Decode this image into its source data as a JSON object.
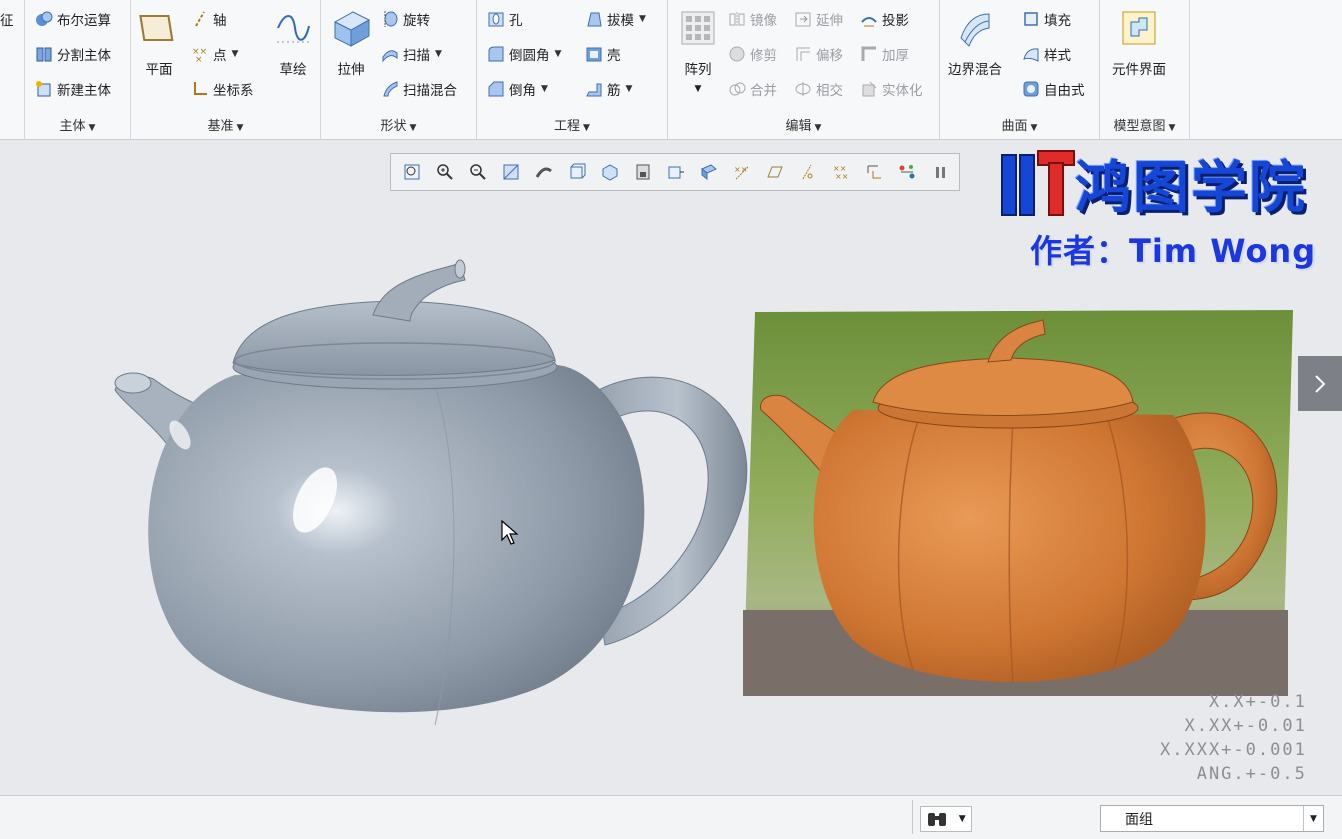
{
  "ribbon": {
    "cut_label": "征",
    "groups": {
      "body": {
        "label": "主体",
        "items": [
          "布尔运算",
          "分割主体",
          "新建主体"
        ]
      },
      "datum": {
        "label": "基准",
        "plane": "平面",
        "axis": "轴",
        "point": "点",
        "csys": "坐标系",
        "sketch": "草绘"
      },
      "shapes": {
        "label": "形状",
        "extrude": "拉伸",
        "revolve": "旋转",
        "sweep": "扫描",
        "swept_blend": "扫描混合"
      },
      "engineering": {
        "label": "工程",
        "hole": "孔",
        "round": "倒圆角",
        "chamfer": "倒角",
        "draft": "拔模",
        "shell": "壳",
        "rib": "筋"
      },
      "editing": {
        "label": "编辑",
        "pattern": "阵列",
        "mirror": "镜像",
        "extend": "延伸",
        "project": "投影",
        "trim": "修剪",
        "offset": "偏移",
        "thicken": "加厚",
        "merge": "合并",
        "intersect": "相交",
        "solidify": "实体化"
      },
      "surfaces": {
        "label": "曲面",
        "boundary_blend": "边界混合",
        "fill": "填充",
        "style": "样式",
        "freestyle": "自由式"
      },
      "model_intent": {
        "label": "模型意图",
        "component_interface": "元件界面"
      }
    }
  },
  "watermark": {
    "brand": "鸿图学院",
    "author": "作者：Tim Wong"
  },
  "tolerance": [
    "X.X+-0.1",
    "X.XX+-0.01",
    "X.XXX+-0.001",
    "ANG.+-0.5"
  ],
  "statusbar": {
    "filter_value": "面组"
  },
  "colors": {
    "model_gray": "#98a4b3",
    "photo_clay": "#d07a3a",
    "logo_blue": "#1546d6"
  }
}
